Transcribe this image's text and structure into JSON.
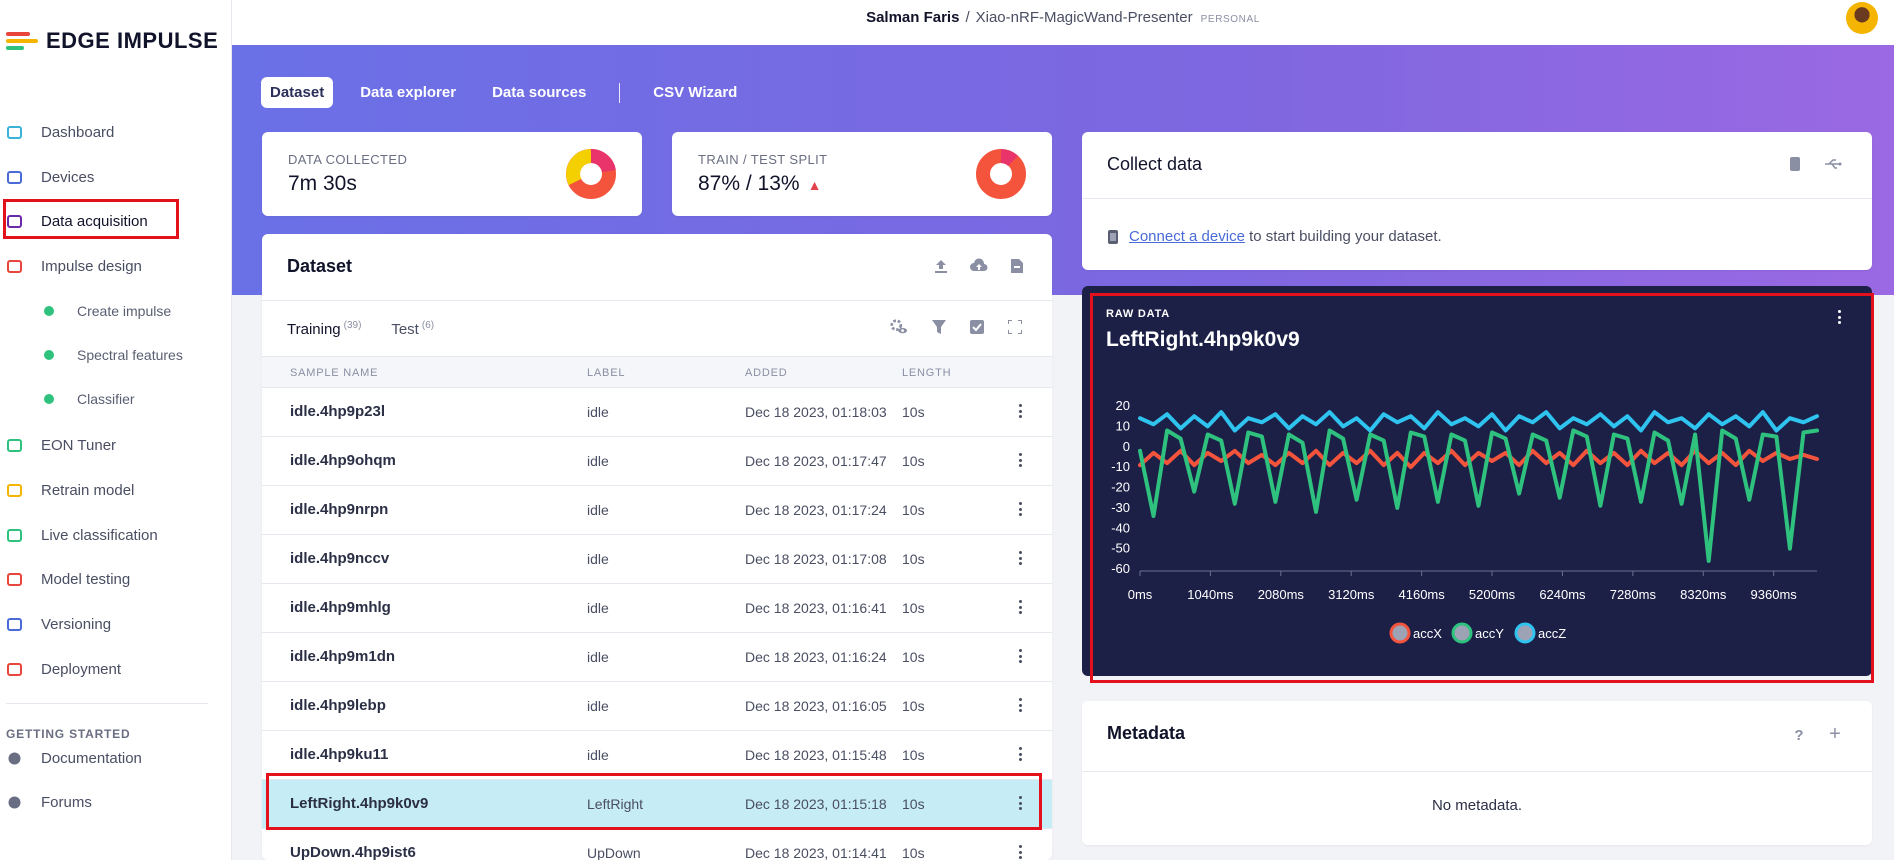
{
  "app": {
    "logo_text": "EDGE IMPULSE",
    "brand_colors": [
      "#e8453c",
      "#f4b400",
      "#2ec27e",
      "#4285f4"
    ]
  },
  "header": {
    "user": "Salman Faris",
    "separator": "/",
    "project": "Xiao-nRF-MagicWand-Presenter",
    "project_badge": "PERSONAL"
  },
  "sidebar": {
    "items": [
      {
        "label": "Dashboard",
        "icon": "monitor-icon",
        "color": "#3bb3d8"
      },
      {
        "label": "Devices",
        "icon": "chip-icon",
        "color": "#4a6ad8"
      },
      {
        "label": "Data acquisition",
        "icon": "database-icon",
        "color": "#6a2aa8"
      },
      {
        "label": "Impulse design",
        "icon": "pulse-icon",
        "color": "#e8453c"
      },
      {
        "label": "Create impulse",
        "icon": "dot-icon",
        "color": "#2ec27e"
      },
      {
        "label": "Spectral features",
        "icon": "dot-icon",
        "color": "#2ec27e"
      },
      {
        "label": "Classifier",
        "icon": "dot-icon",
        "color": "#2ec27e"
      },
      {
        "label": "EON Tuner",
        "icon": "compass-icon",
        "color": "#2ec27e"
      },
      {
        "label": "Retrain model",
        "icon": "shuffle-icon",
        "color": "#f4b400"
      },
      {
        "label": "Live classification",
        "icon": "network-icon",
        "color": "#2ec27e"
      },
      {
        "label": "Model testing",
        "icon": "clipboard-check-icon",
        "color": "#e8453c"
      },
      {
        "label": "Versioning",
        "icon": "branch-icon",
        "color": "#4a6ad8"
      },
      {
        "label": "Deployment",
        "icon": "box-icon",
        "color": "#e8453c"
      }
    ],
    "section_title": "GETTING STARTED",
    "footer_items": [
      {
        "label": "Documentation",
        "icon": "rocket-icon"
      },
      {
        "label": "Forums",
        "icon": "chat-icon"
      }
    ]
  },
  "tabs": {
    "items": [
      "Dataset",
      "Data explorer",
      "Data sources",
      "CSV Wizard"
    ],
    "active": "Dataset"
  },
  "stats": {
    "collected_label": "DATA COLLECTED",
    "collected_value": "7m 30s",
    "split_label": "TRAIN / TEST SPLIT",
    "split_value": "87% / 13%"
  },
  "dataset": {
    "title": "Dataset",
    "subtabs": [
      {
        "label": "Training",
        "count": "(39)"
      },
      {
        "label": "Test",
        "count": "(6)"
      }
    ],
    "columns": [
      "SAMPLE NAME",
      "LABEL",
      "ADDED",
      "LENGTH"
    ],
    "rows": [
      {
        "name": "idle.4hp9p23l",
        "label": "idle",
        "added": "Dec 18 2023, 01:18:03",
        "length": "10s"
      },
      {
        "name": "idle.4hp9ohqm",
        "label": "idle",
        "added": "Dec 18 2023, 01:17:47",
        "length": "10s"
      },
      {
        "name": "idle.4hp9nrpn",
        "label": "idle",
        "added": "Dec 18 2023, 01:17:24",
        "length": "10s"
      },
      {
        "name": "idle.4hp9nccv",
        "label": "idle",
        "added": "Dec 18 2023, 01:17:08",
        "length": "10s"
      },
      {
        "name": "idle.4hp9mhlg",
        "label": "idle",
        "added": "Dec 18 2023, 01:16:41",
        "length": "10s"
      },
      {
        "name": "idle.4hp9m1dn",
        "label": "idle",
        "added": "Dec 18 2023, 01:16:24",
        "length": "10s"
      },
      {
        "name": "idle.4hp9lebp",
        "label": "idle",
        "added": "Dec 18 2023, 01:16:05",
        "length": "10s"
      },
      {
        "name": "idle.4hp9ku11",
        "label": "idle",
        "added": "Dec 18 2023, 01:15:48",
        "length": "10s"
      },
      {
        "name": "LeftRight.4hp9k0v9",
        "label": "LeftRight",
        "added": "Dec 18 2023, 01:15:18",
        "length": "10s"
      },
      {
        "name": "UpDown.4hp9ist6",
        "label": "UpDown",
        "added": "Dec 18 2023, 01:14:41",
        "length": "10s"
      }
    ],
    "selected_index": 8
  },
  "collect": {
    "title": "Collect data",
    "link": "Connect a device",
    "text": " to start building your dataset."
  },
  "raw": {
    "label": "RAW DATA",
    "title": "LeftRight.4hp9k0v9"
  },
  "metadata": {
    "title": "Metadata",
    "empty": "No metadata."
  },
  "chart_data": {
    "type": "line",
    "xlabel": "",
    "ylabel": "",
    "ylim": [
      -60,
      20
    ],
    "xlim": [
      0,
      10000
    ],
    "yticks": [
      20,
      10,
      0,
      -10,
      -20,
      -30,
      -40,
      -50,
      -60
    ],
    "xticks": [
      "0ms",
      "1040ms",
      "2080ms",
      "3120ms",
      "4160ms",
      "5200ms",
      "6240ms",
      "7280ms",
      "8320ms",
      "9360ms"
    ],
    "legend": "bottom-center",
    "grid": false,
    "x": [
      0,
      200,
      400,
      600,
      800,
      1000,
      1200,
      1400,
      1600,
      1800,
      2000,
      2200,
      2400,
      2600,
      2800,
      3000,
      3200,
      3400,
      3600,
      3800,
      4000,
      4200,
      4400,
      4600,
      4800,
      5000,
      5200,
      5400,
      5600,
      5800,
      6000,
      6200,
      6400,
      6600,
      6800,
      7000,
      7200,
      7400,
      7600,
      7800,
      8000,
      8200,
      8400,
      8600,
      8800,
      9000,
      9200,
      9400,
      9600,
      9800,
      10000
    ],
    "series": [
      {
        "name": "accX",
        "color": "#f4543c",
        "values": [
          -9,
          -3,
          -8,
          -2,
          -9,
          -3,
          -7,
          -2,
          -8,
          -4,
          -9,
          -3,
          -8,
          -2,
          -9,
          -3,
          -8,
          -2,
          -9,
          -3,
          -10,
          -3,
          -8,
          -2,
          -9,
          -3,
          -7,
          -3,
          -9,
          -2,
          -8,
          -3,
          -9,
          -2,
          -8,
          -3,
          -9,
          -2,
          -8,
          -3,
          -9,
          -2,
          -8,
          -3,
          -9,
          -2,
          -7,
          -3,
          -6,
          -4,
          -6
        ]
      },
      {
        "name": "accY",
        "color": "#2ec27e",
        "values": [
          -2,
          -34,
          8,
          4,
          -22,
          6,
          3,
          -28,
          7,
          5,
          -27,
          6,
          2,
          -32,
          8,
          4,
          -26,
          6,
          3,
          -30,
          7,
          5,
          -27,
          6,
          3,
          -29,
          7,
          4,
          -23,
          6,
          3,
          -25,
          8,
          5,
          -29,
          6,
          4,
          -27,
          7,
          3,
          -28,
          6,
          -56,
          8,
          4,
          -26,
          6,
          5,
          -50,
          7,
          8
        ]
      },
      {
        "name": "accZ",
        "color": "#2fc3f0",
        "values": [
          14,
          11,
          16,
          9,
          15,
          10,
          17,
          8,
          14,
          12,
          16,
          9,
          15,
          11,
          17,
          10,
          14,
          8,
          16,
          12,
          15,
          9,
          17,
          11,
          14,
          10,
          16,
          8,
          15,
          12,
          17,
          9,
          14,
          11,
          16,
          10,
          15,
          8,
          17,
          12,
          14,
          9,
          16,
          11,
          15,
          10,
          17,
          8,
          14,
          12,
          15
        ]
      }
    ]
  }
}
